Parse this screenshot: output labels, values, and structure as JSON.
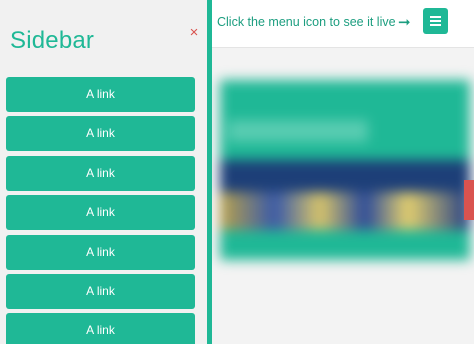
{
  "sidebar": {
    "title": "Sidebar",
    "close_icon": "close-icon",
    "close_glyph": "×",
    "links": [
      {
        "label": "A link"
      },
      {
        "label": "A link"
      },
      {
        "label": "A link"
      },
      {
        "label": "A link"
      },
      {
        "label": "A link"
      },
      {
        "label": "A link"
      },
      {
        "label": "A link"
      }
    ]
  },
  "topbar": {
    "hint": "Click the menu icon to see it live",
    "arrow_icon": "arrow-right-icon",
    "arrow_glyph": "➞",
    "menu_icon": "hamburger-menu-icon"
  },
  "colors": {
    "accent": "#1fb896",
    "close": "#d9534f",
    "sidebar_bg": "#f1f1f1"
  }
}
